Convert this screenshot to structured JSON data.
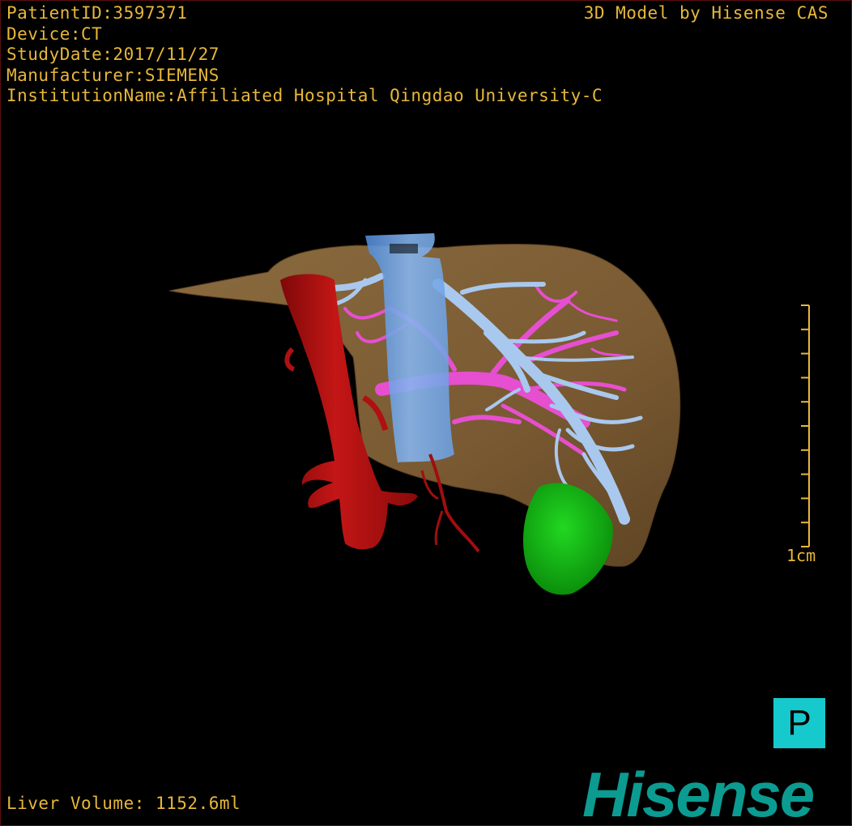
{
  "header": {
    "patient_id": "PatientID:3597371",
    "device": "Device:CT",
    "study_date": "StudyDate:2017/11/27",
    "manufacturer": "Manufacturer:SIEMENS",
    "institution": "InstitutionName:Affiliated Hospital Qingdao University-C"
  },
  "brand_caption": "3D Model by Hisense CAS",
  "footer": {
    "liver_volume": "Liver Volume: 1152.6ml"
  },
  "scale_bar": {
    "label": "1cm",
    "tick_count": 11,
    "color": "#e8b73a"
  },
  "orientation_marker": {
    "label": "P",
    "color": "#16c9cc"
  },
  "logo": {
    "text": "Hisense",
    "color": "#0b9b91"
  },
  "model": {
    "structures": [
      {
        "name": "liver",
        "color": "#7a5a32"
      },
      {
        "name": "inferior vena cava",
        "color": "#6fa6e6"
      },
      {
        "name": "aorta",
        "color": "#b01010"
      },
      {
        "name": "portal vein",
        "color": "#e64fd0"
      },
      {
        "name": "hepatic veins",
        "color": "#a9c8ee"
      },
      {
        "name": "gallbladder",
        "color": "#13b513"
      }
    ]
  }
}
